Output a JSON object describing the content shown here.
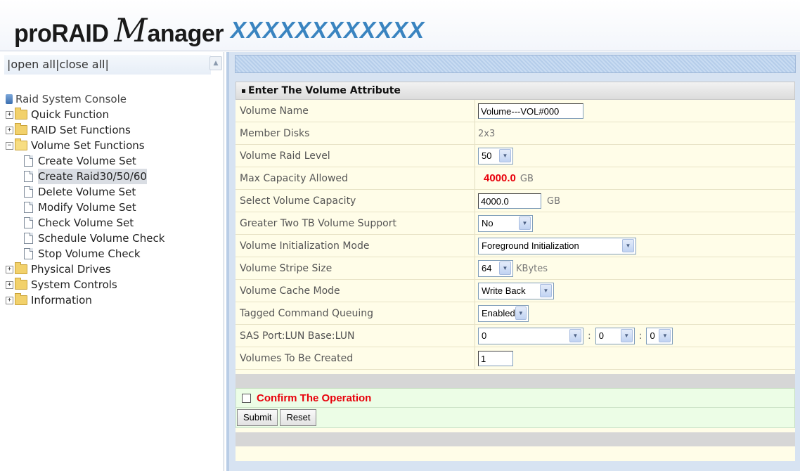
{
  "header": {
    "logo": {
      "part1": "proRAID",
      "part2": "M",
      "part3": "anager"
    },
    "model": "XXXXXXXXXXXX"
  },
  "sidebar": {
    "open_all": "open all",
    "close_all": "close all",
    "root": "Raid System Console",
    "folders": [
      {
        "label": "Quick Function",
        "expander": "+"
      },
      {
        "label": "RAID Set Functions",
        "expander": "+"
      },
      {
        "label": "Volume Set Functions",
        "expander": "−"
      }
    ],
    "volume_items": [
      "Create Volume Set",
      "Create Raid30/50/60",
      "Delete Volume Set",
      "Modify Volume Set",
      "Check Volume Set",
      "Schedule Volume Check",
      "Stop Volume Check"
    ],
    "more_folders": [
      {
        "label": "Physical Drives",
        "expander": "+"
      },
      {
        "label": "System Controls",
        "expander": "+"
      },
      {
        "label": "Information",
        "expander": "+"
      }
    ]
  },
  "panel": {
    "title": "Enter The Volume Attribute",
    "rows": {
      "volume_name": {
        "label": "Volume Name",
        "value": "Volume---VOL#000"
      },
      "member_disks": {
        "label": "Member Disks",
        "value": "2x3"
      },
      "raid_level": {
        "label": "Volume Raid Level",
        "value": "50"
      },
      "max_capacity": {
        "label": "Max Capacity Allowed",
        "value": "4000.0",
        "unit": "GB"
      },
      "select_capacity": {
        "label": "Select Volume Capacity",
        "value": "4000.0",
        "unit": "GB"
      },
      "greater_two_tb": {
        "label": "Greater Two TB Volume Support",
        "value": "No"
      },
      "init_mode": {
        "label": "Volume Initialization Mode",
        "value": "Foreground Initialization"
      },
      "stripe_size": {
        "label": "Volume Stripe Size",
        "value": "64",
        "unit": "KBytes"
      },
      "cache_mode": {
        "label": "Volume Cache Mode",
        "value": "Write Back"
      },
      "tcq": {
        "label": "Tagged Command Queuing",
        "value": "Enabled"
      },
      "sas_port": {
        "label": "SAS Port:LUN Base:LUN",
        "port": "0",
        "lun_base": "0",
        "lun": "0",
        "sep": ":"
      },
      "volumes_count": {
        "label": "Volumes To Be Created",
        "value": "1"
      }
    },
    "confirm_label": "Confirm The Operation",
    "submit_label": "Submit",
    "reset_label": "Reset"
  }
}
